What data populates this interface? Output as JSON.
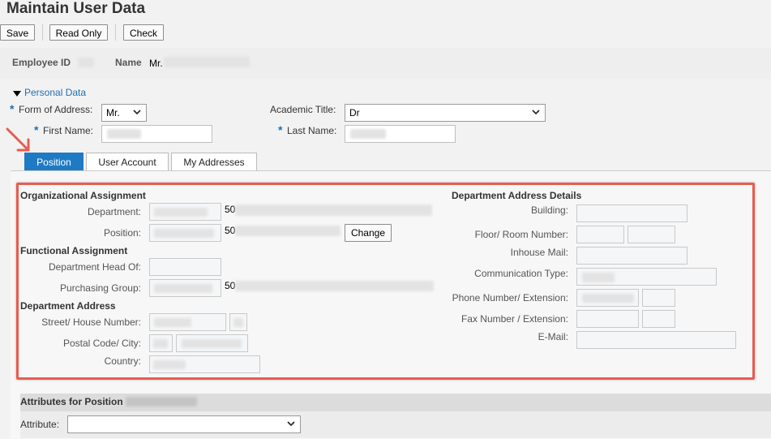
{
  "page": {
    "title": "Maintain User Data"
  },
  "toolbar": {
    "save_label": "Save",
    "readonly_label": "Read Only",
    "check_label": "Check"
  },
  "header": {
    "employee_id_label": "Employee ID",
    "name_label": "Name",
    "name_prefix": "Mr."
  },
  "personal": {
    "section_label": "Personal Data",
    "form_of_address_label": "Form of Address:",
    "form_of_address_value": "Mr.",
    "academic_title_label": "Academic Title:",
    "academic_title_value": "Dr",
    "first_name_label": "First Name:",
    "last_name_label": "Last Name:",
    "required_marker": "*"
  },
  "tabs": [
    {
      "label": "Position",
      "active": true
    },
    {
      "label": "User Account",
      "active": false
    },
    {
      "label": "My Addresses",
      "active": false
    }
  ],
  "org": {
    "heading": "Organizational Assignment",
    "department_label": "Department:",
    "department_code": "50",
    "position_label": "Position:",
    "position_code": "50",
    "change_label": "Change"
  },
  "functional": {
    "heading": "Functional Assignment",
    "dept_head_label": "Department Head Of:",
    "purchasing_label": "Purchasing Group:",
    "purchasing_code": "50"
  },
  "dept_address": {
    "heading": "Department Address",
    "street_label": "Street/ House Number:",
    "postal_label": "Postal Code/ City:",
    "country_label": "Country:"
  },
  "dept_details": {
    "heading": "Department Address Details",
    "building_label": "Building:",
    "floor_label": "Floor/ Room Number:",
    "inhouse_label": "Inhouse Mail:",
    "comm_type_label": "Communication Type:",
    "phone_label": "Phone Number/ Extension:",
    "fax_label": "Fax Number / Extension:",
    "email_label": "E-Mail:"
  },
  "attributes": {
    "heading": "Attributes for Position",
    "attribute_label": "Attribute:"
  },
  "colors": {
    "accent": "#1f7ac4",
    "highlight": "#e85c4f"
  }
}
